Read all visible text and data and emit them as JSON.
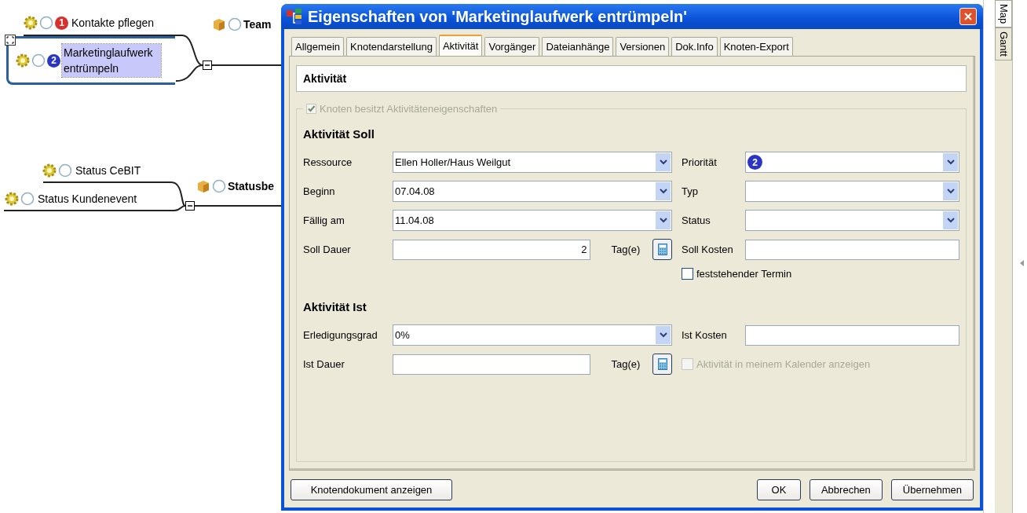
{
  "mindmap": {
    "nodes": [
      {
        "kind": "task",
        "label": "Kontakte pflegen",
        "priority": "1",
        "color": "#d8302e",
        "selected": false
      },
      {
        "kind": "task",
        "label": "Marketinglaufwerk entrümpeln",
        "priority": "2",
        "color": "#2b35c4",
        "selected": true
      },
      {
        "kind": "topic",
        "label": "Team"
      },
      {
        "kind": "task",
        "label": "Status CeBIT",
        "selected": false
      },
      {
        "kind": "task",
        "label": "Status Kundenevent",
        "selected": false
      },
      {
        "kind": "topic",
        "label": "Statusbe"
      }
    ]
  },
  "dialog": {
    "title": "Eigenschaften von 'Marketinglaufwerk entrümpeln'",
    "tabs": [
      {
        "label": "Allgemein",
        "selected": false
      },
      {
        "label": "Knotendarstellung",
        "selected": false
      },
      {
        "label": "Aktivität",
        "selected": true
      },
      {
        "label": "Vorgänger",
        "selected": false
      },
      {
        "label": "Dateianhänge",
        "selected": false
      },
      {
        "label": "Versionen",
        "selected": false
      },
      {
        "label": "Dok.Info",
        "selected": false
      },
      {
        "label": "Knoten-Export",
        "selected": false
      }
    ],
    "header": "Aktivität",
    "group_checkbox": {
      "label": "Knoten besitzt Aktivitäteneigenschaften",
      "checked": true,
      "disabled": true
    },
    "sections": [
      {
        "title": "Aktivität Soll",
        "rows": [
          {
            "left": {
              "kind": "combo",
              "label": "Ressource",
              "value": "Ellen Holler/Haus Weilgut"
            },
            "right": {
              "kind": "priority",
              "label": "Priorität",
              "value": "2",
              "color": "#2b35c4"
            }
          },
          {
            "left": {
              "kind": "combo",
              "label": "Beginn",
              "value": "07.04.08"
            },
            "right": {
              "kind": "combo",
              "label": "Typ"
            }
          },
          {
            "left": {
              "kind": "combo",
              "label": "Fällig am",
              "value": "11.04.08"
            },
            "right": {
              "kind": "combo",
              "label": "Status"
            }
          },
          {
            "left": {
              "kind": "duration",
              "label": "Soll Dauer",
              "value": "2",
              "unit": "Tag(e)"
            },
            "right": {
              "kind": "text",
              "label": "Soll Kosten"
            }
          },
          {
            "right": {
              "kind": "checkbox",
              "label": "feststehender Termin",
              "checked": false,
              "disabled": false
            }
          }
        ]
      },
      {
        "title": "Aktivität Ist",
        "rows": [
          {
            "left": {
              "kind": "combo",
              "label": "Erledigungsgrad",
              "value": "0%"
            },
            "right": {
              "kind": "text",
              "label": "Ist Kosten"
            }
          },
          {
            "left": {
              "kind": "duration",
              "label": "Ist Dauer",
              "unit": "Tag(e)"
            },
            "right": {
              "kind": "checkbox",
              "label": "Aktivität in meinem Kalender anzeigen",
              "checked": false,
              "disabled": true
            }
          }
        ]
      }
    ],
    "left_buttons": [
      "Knotendokument anzeigen"
    ],
    "right_buttons": [
      "OK",
      "Abbrechen",
      "Übernehmen"
    ]
  },
  "side_tabs": [
    {
      "label": "Map",
      "selected": true
    },
    {
      "label": "Gantt",
      "selected": false
    }
  ]
}
